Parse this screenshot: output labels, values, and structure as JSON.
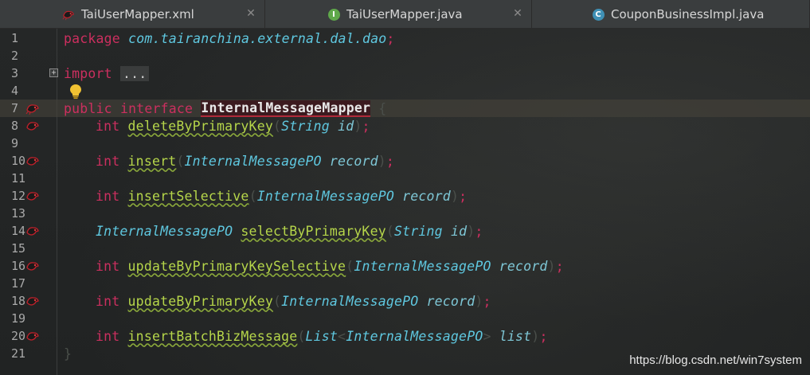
{
  "tabs": [
    {
      "label": "TaiUserMapper.xml",
      "icon": "mybatis-bird-icon",
      "active": false,
      "has_close": true
    },
    {
      "label": "TaiUserMapper.java",
      "icon": "interface-i-icon",
      "active": false,
      "has_close": true
    },
    {
      "label": "CouponBusinessImpl.java",
      "icon": "class-c-icon",
      "active": false,
      "has_close": false
    }
  ],
  "icons": {
    "interface_letter": "I",
    "class_letter": "C",
    "close_glyph": "✕",
    "fold_glyph": "+"
  },
  "colors": {
    "keyword": "#cc2f5f",
    "type": "#5fc8e0",
    "method": "#b6d64a",
    "interface_icon": "#5fa84a",
    "class_icon": "#3f90b5"
  },
  "code": {
    "line_numbers": [
      "1",
      "2",
      "3",
      "4",
      "7",
      "8",
      "9",
      "10",
      "11",
      "12",
      "13",
      "14",
      "15",
      "16",
      "17",
      "18",
      "19",
      "20",
      "21"
    ],
    "package_kw": "package",
    "package_name": "com.tairanchina.external.dal.dao",
    "package_semi": ";",
    "import_kw": "import",
    "import_fold": "...",
    "public_kw": "public",
    "interface_kw": "interface",
    "interface_name": "InternalMessageMapper",
    "open_brace": "{",
    "close_brace": "}",
    "methods": [
      {
        "ret": "int",
        "name": "deleteByPrimaryKey",
        "ptype": "String",
        "pname": "id",
        "ret_is_type": false
      },
      {
        "ret": "int",
        "name": "insert",
        "ptype": "InternalMessagePO",
        "pname": "record",
        "ret_is_type": false
      },
      {
        "ret": "int",
        "name": "insertSelective",
        "ptype": "InternalMessagePO",
        "pname": "record",
        "ret_is_type": false
      },
      {
        "ret": "InternalMessagePO",
        "name": "selectByPrimaryKey",
        "ptype": "String",
        "pname": "id",
        "ret_is_type": true
      },
      {
        "ret": "int",
        "name": "updateByPrimaryKeySelective",
        "ptype": "InternalMessagePO",
        "pname": "record",
        "ret_is_type": false
      },
      {
        "ret": "int",
        "name": "updateByPrimaryKey",
        "ptype": "InternalMessagePO",
        "pname": "record",
        "ret_is_type": false
      }
    ],
    "batch_method": {
      "ret": "int",
      "name": "insertBatchBizMessage",
      "list_type": "List",
      "generic_open": "<",
      "generic_type": "InternalMessagePO",
      "generic_close": ">",
      "pname": "list"
    },
    "paren_open": "(",
    "paren_close": ")",
    "semi": ";"
  },
  "watermark": "https://blog.csdn.net/win7system"
}
